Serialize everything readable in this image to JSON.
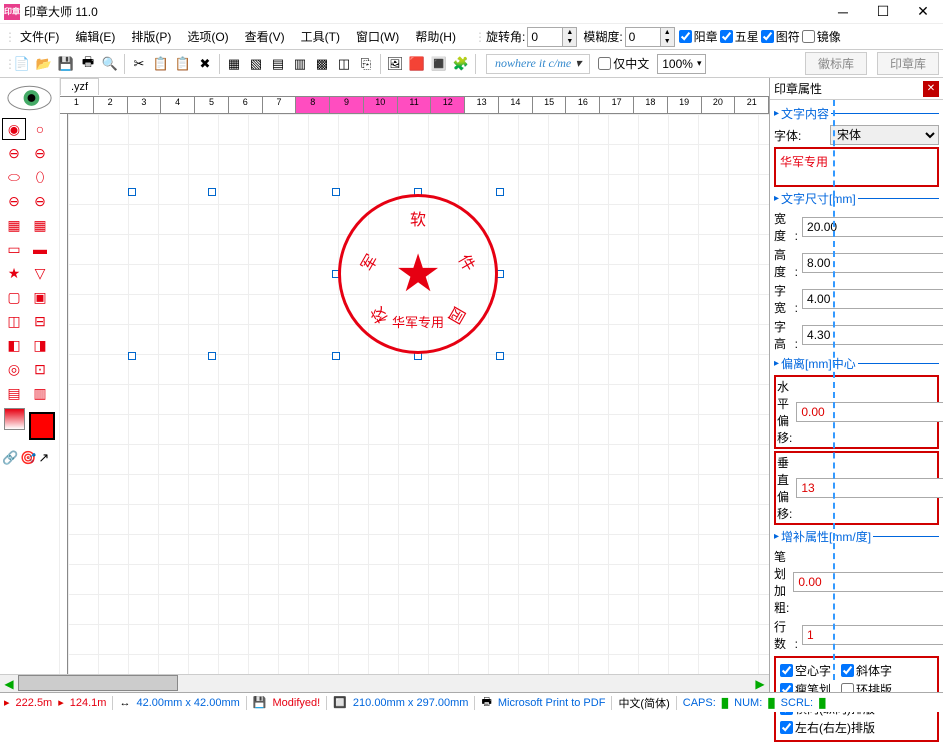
{
  "title": "印章大师 11.0",
  "app_icon_text": "印章",
  "menu": [
    "文件(F)",
    "编辑(E)",
    "排版(P)",
    "选项(O)",
    "查看(V)",
    "工具(T)",
    "窗口(W)",
    "帮助(H)"
  ],
  "ctrl": {
    "rotate_label": "旋转角:",
    "rotate_val": "0",
    "blur_label": "模糊度:",
    "blur_val": "0",
    "chk_yang": "阳章",
    "chk_star": "五星",
    "chk_tufu": "图符",
    "chk_mirror": "镜像"
  },
  "toolbar_icons": [
    "📄",
    "📂",
    "💾",
    "🖶",
    "🔍",
    "|",
    "✂",
    "📋",
    "📋",
    "✖",
    "|",
    "▦",
    "▧",
    "▤",
    "▥",
    "▩",
    "◫",
    "⎘",
    "|",
    "🖼",
    "🟥",
    "🔳",
    "🧩",
    "|"
  ],
  "font_preview": "nowhere it c/me",
  "only_cn": "仅中文",
  "zoom": "100%",
  "tab1": "徽标库",
  "tab2": "印章库",
  "doc_tab": ".yzf",
  "ruler_nums": [
    "1",
    "2",
    "3",
    "4",
    "5",
    "6",
    "7",
    "8",
    "9",
    "10",
    "11",
    "12",
    "13",
    "14",
    "15",
    "16",
    "17",
    "18",
    "19",
    "20",
    "21"
  ],
  "ruler_pink_from": 8,
  "ruler_pink_to": 12,
  "seal": {
    "chars": [
      "军",
      "软",
      "件",
      "园",
      "校"
    ],
    "bottom_text": "华军专用"
  },
  "panel": {
    "title": "印章属性",
    "s1": "文字内容",
    "font_label": "字体:",
    "font_val": "宋体",
    "text_content": "华军专用",
    "s2": "文字尺寸[mm]",
    "width_l": "宽　度:",
    "width_v": "20.00",
    "height_l": "高　度:",
    "height_v": "8.00",
    "cw_l": "字　宽:",
    "cw_v": "4.00",
    "ch_l": "字　高:",
    "ch_v": "4.30",
    "s3": "偏离[mm]中心",
    "hoff_l": "水平偏移:",
    "hoff_v": "0.00",
    "voff_l": "垂直偏移:",
    "voff_v": "13",
    "s4": "增补属性[mm/度]",
    "bold_l": "笔划加粗:",
    "bold_v": "0.00",
    "rows_l": "行　数:",
    "rows_v": "1",
    "opt_hollow": "空心字",
    "opt_italic": "斜体字",
    "opt_thin": "瘦笔划",
    "opt_ring": "环排版",
    "opt_hv": "横向(纵向)排版",
    "opt_lr": "左右(右左)排版"
  },
  "status": {
    "x": "222.5m",
    "y": "124.1m",
    "size": "42.00mm x 42.00mm",
    "modified": "Modifyed!",
    "page": "210.00mm x 297.00mm",
    "printer": "Microsoft Print to PDF",
    "lang": "中文(简体)",
    "caps": "CAPS:",
    "num": "NUM:",
    "scrl": "SCRL:"
  }
}
